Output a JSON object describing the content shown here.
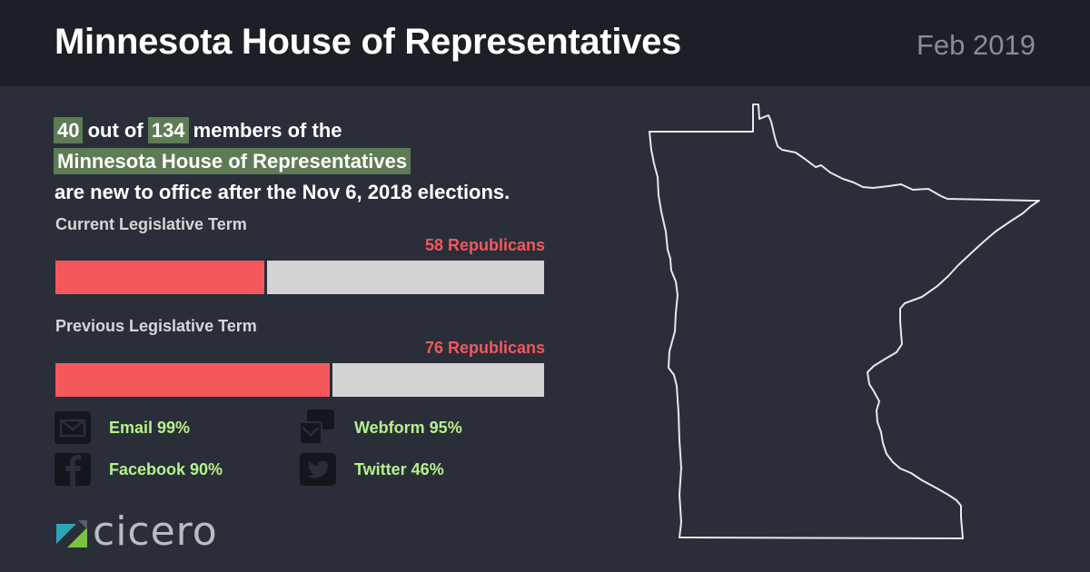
{
  "header": {
    "title": "Minnesota House of Representatives",
    "date": "Feb 2019"
  },
  "headline": {
    "new_count": "40",
    "out_of": "out of",
    "total": "134",
    "members_of_the": "members of the",
    "body_name": "Minnesota House of Representatives",
    "line3": "are new to office after the Nov 6, 2018 elections."
  },
  "current_term": {
    "label": "Current Legislative Term",
    "republican_label": "58 Republicans",
    "republicans": 58,
    "total_seats": 134
  },
  "previous_term": {
    "label": "Previous Legislative Term",
    "republican_label": "76 Republicans",
    "republicans": 76,
    "total_seats": 134
  },
  "contacts": [
    {
      "icon": "email-icon",
      "label": "Email 99%"
    },
    {
      "icon": "webform-icon",
      "label": "Webform 95%"
    },
    {
      "icon": "facebook-icon",
      "label": "Facebook 90%"
    },
    {
      "icon": "twitter-icon",
      "label": "Twitter 46%"
    }
  ],
  "logo": {
    "text": "cicero"
  },
  "colors": {
    "republican": "#f4585c",
    "highlight": "#5e7b56",
    "contact_text": "#b6f18a",
    "background": "#2a2e39",
    "header_background": "#1c1f26"
  }
}
